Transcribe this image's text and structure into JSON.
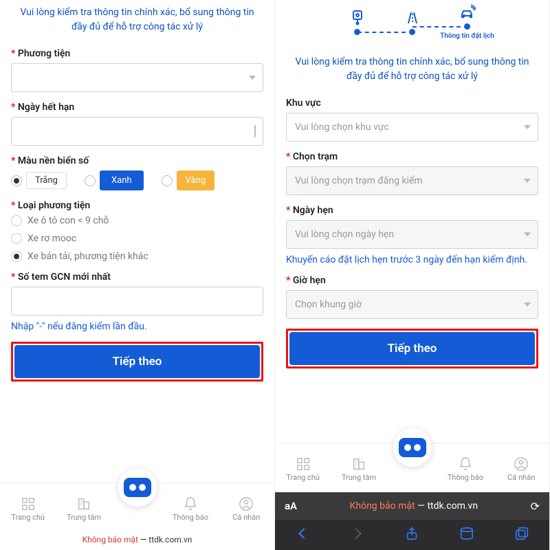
{
  "left": {
    "instruction_l1": "Vui lòng kiểm tra thông tin chính xác, bổ sung thông tin",
    "instruction_l2": "đầy đủ để hỗ trợ công tác xử lý",
    "fields": {
      "vehicle_label": "Phương tiện",
      "expiry_label": "Ngày hết hạn",
      "plate_color_label": "Màu nền biển số",
      "plate_colors": {
        "white": "Trắng",
        "blue": "Xanh",
        "yellow": "Vàng"
      },
      "vehicle_type_label": "Loại phương tiện",
      "vehicle_types": {
        "a": "Xe ô tô con < 9 chỗ",
        "b": "Xe rơ mooc",
        "c": "Xe bán tải, phương tiện khác"
      },
      "stamp_label": "Số tem GCN mới nhất",
      "stamp_hint": "Nhập \"-\" nếu đăng kiểm lần đầu."
    },
    "next_button": "Tiếp theo"
  },
  "right": {
    "step_label": "Thông tin đặt lịch",
    "instruction_l1": "Vui lòng kiểm tra thông tin chính xác, bổ sung thông tin",
    "instruction_l2": "đầy đủ để hỗ trợ công tác xử lý",
    "area_label": "Khu vực",
    "area_placeholder": "Vui lòng chọn khu vực",
    "station_label": "Chọn trạm",
    "station_placeholder": "Vui lòng chọn trạm đăng kiểm",
    "date_label": "Ngày hẹn",
    "date_placeholder": "Vui lòng chọn ngày hẹn",
    "date_hint": "Khuyến cáo đặt lịch hẹn trước 3 ngày đến hạn kiểm định.",
    "time_label": "Giờ hẹn",
    "time_placeholder": "Chọn khung giờ",
    "next_button": "Tiếp theo"
  },
  "nav": {
    "home": "Trang chủ",
    "center": "Trung tâm",
    "notify": "Thông báo",
    "profile": "Cá nhân"
  },
  "footer": {
    "warn": "Không bảo mật",
    "dash": " — ",
    "domain": "ttdk.com.vn"
  },
  "safari": {
    "aA": "aA",
    "warn": "Không bảo mật",
    "dash": " — ",
    "domain": "ttdk.com.vn"
  }
}
